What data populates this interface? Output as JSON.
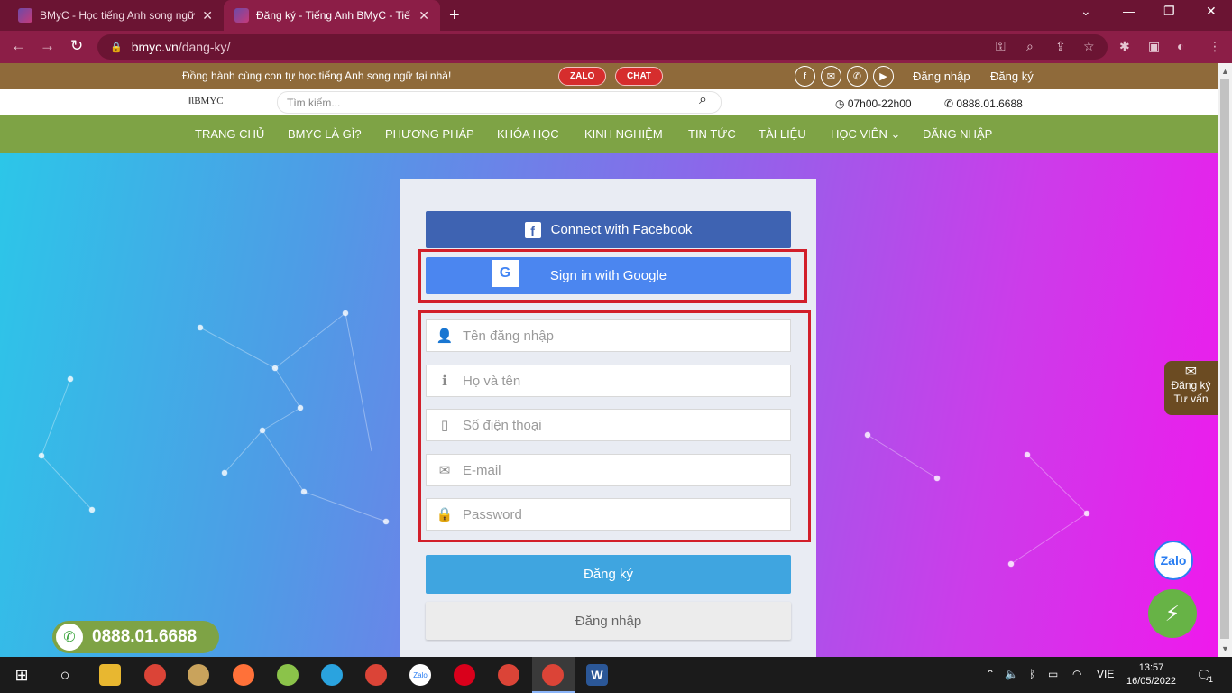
{
  "browser": {
    "tabs": [
      {
        "title": "BMyC - Học tiếng Anh song ngữ"
      },
      {
        "title": "Đăng ký - Tiếng Anh BMyC - Tiế"
      }
    ],
    "url_host": "bmyc.vn",
    "url_path": "/dang-ky/"
  },
  "topbar": {
    "tagline": "Đồng hành cùng con tự học tiếng Anh song ngữ tại nhà!",
    "zalo": "ZALO",
    "chat": "CHAT",
    "login": "Đăng nhập",
    "register": "Đăng ký"
  },
  "header": {
    "logo": "BMYC",
    "search_placeholder": "Tìm kiếm...",
    "hours": "07h00-22h00",
    "phone": "0888.01.6688"
  },
  "nav": [
    "TRANG CHỦ",
    "BMYC LÀ GÌ?",
    "PHƯƠNG PHÁP",
    "KHÓA HỌC",
    "KINH NGHIỆM",
    "TIN TỨC",
    "TÀI LIỆU",
    "HỌC VIÊN",
    "ĐĂNG NHẬP"
  ],
  "form": {
    "facebook": "Connect with Facebook",
    "google": "Sign in with Google",
    "fields": [
      {
        "placeholder": "Tên đăng nhập",
        "icon": "user-icon"
      },
      {
        "placeholder": "Họ và tên",
        "icon": "info-icon"
      },
      {
        "placeholder": "Số điện thoại",
        "icon": "mobile-icon"
      },
      {
        "placeholder": "E-mail",
        "icon": "envelope-icon"
      },
      {
        "placeholder": "Password",
        "icon": "lock-icon"
      }
    ],
    "register_button": "Đăng ký",
    "login_button": "Đăng nhập"
  },
  "floating": {
    "phone": "0888.01.6688",
    "register_line1": "Đăng ký",
    "register_line2": "Tư vấn",
    "zalo": "Zalo"
  },
  "taskbar": {
    "lang": "VIE",
    "time": "13:57",
    "date": "16/05/2022",
    "notifications": "1"
  },
  "colors": {
    "browser_frame": "#8c1e47",
    "topbar": "#8f6a3a",
    "nav": "#7ea345",
    "facebook": "#3e63b2",
    "google": "#4b86f0",
    "register": "#3fa5e0",
    "highlight": "#d21f2a"
  }
}
